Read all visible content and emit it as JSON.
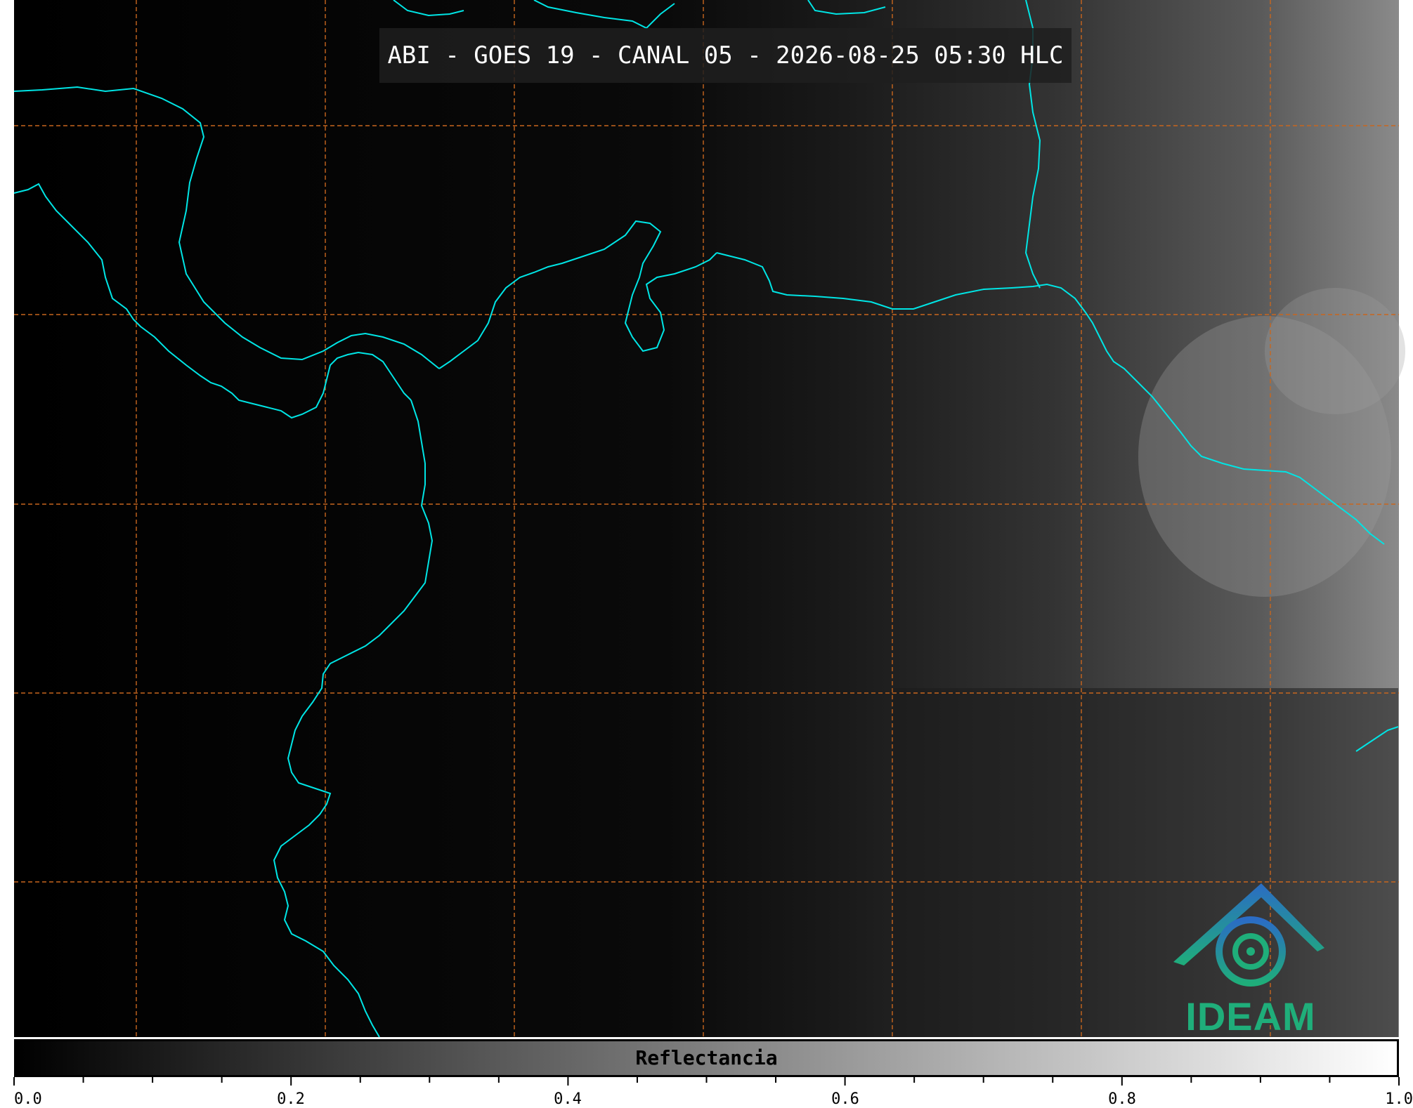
{
  "title": "ABI - GOES 19 - CANAL 05 - 2026-08-25 05:30 HLC",
  "colorbar": {
    "label": "Reflectancia",
    "ticks": [
      "0.0",
      "0.2",
      "0.4",
      "0.6",
      "0.8",
      "1.0"
    ],
    "range": [
      0.0,
      1.0
    ]
  },
  "logo": {
    "text": "IDEAM"
  },
  "colors": {
    "coastline": "#00e5e5",
    "graticule": "#c8661e",
    "logo_blue": "#2b6cc4",
    "logo_green": "#1fae7a"
  }
}
